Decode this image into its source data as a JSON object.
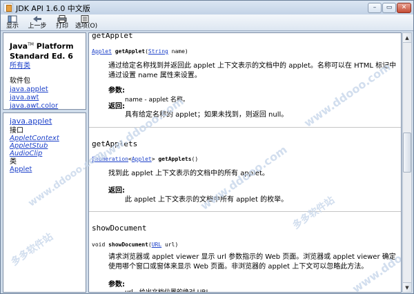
{
  "window": {
    "title": "JDK API 1.6.0 中文版",
    "controls": [
      "–",
      "▭",
      "✕"
    ]
  },
  "toolbar": {
    "buttons": [
      {
        "label": "显示",
        "icon": "show-icon"
      },
      {
        "label": "上一步",
        "icon": "back-arrow-icon"
      },
      {
        "label": "打印",
        "icon": "print-icon"
      },
      {
        "label": "选项(O)",
        "icon": "options-icon"
      }
    ]
  },
  "top_pane": {
    "title": "Java™ Platform Standard Ed. 6",
    "title_tm": "TM",
    "title_pre": "Java",
    "title_post": " Platform Standard Ed. 6",
    "all_classes": "所有类",
    "packages_label": "软件包",
    "packages": [
      "java.applet",
      "java.awt",
      "java.awt.color"
    ]
  },
  "bottom_pane": {
    "package": "java.applet",
    "interfaces_label": "接口",
    "interfaces": [
      "AppletContext",
      "AppletStub",
      "AudioClip"
    ],
    "classes_label": "类",
    "classes": [
      "Applet"
    ]
  },
  "main": {
    "sections": [
      {
        "name": "getApplet",
        "sig_type": "Applet",
        "sig_method": "getApplet",
        "sig_paren_open": "(",
        "sig_param_type": "String",
        "sig_param": " name)",
        "desc": "通过给定名称找到并返回此 applet 上下文表示的文档中的 applet。名称可以在 HTML 标记中通过设置 name 属性来设置。",
        "params_label": "参数:",
        "param_text": "name - applet 名称。",
        "returns_label": "返回:",
        "returns_text": "具有给定名称的 applet；如果未找到，则返回 null。"
      },
      {
        "name": "getApplets",
        "sig_type": "Enumeration",
        "sig_generic_open": "<",
        "sig_generic": "Applet",
        "sig_generic_close": ">",
        "sig_method": " getApplets",
        "sig_rest": "()",
        "desc": "找到此 applet 上下文表示的文档中的所有 applet。",
        "returns_label": "返回:",
        "returns_text": "此 applet 上下文表示的文档中所有 applet 的枚举。"
      },
      {
        "name": "showDocument",
        "sig_pre": "void ",
        "sig_method": "showDocument",
        "sig_paren_open": "(",
        "sig_param_type": "URL",
        "sig_param": " url)",
        "desc": "请求浏览器或 applet viewer 显示 url 参数指示的 Web 页面。浏览器或 applet viewer 确定使用哪个窗口或窗体来显示 Web 页面。非浏览器的 applet 上下文可以忽略此方法。",
        "params_label": "参数:",
        "param_text": "url - 给出文档位置的绝对 URL。"
      }
    ]
  },
  "watermark": {
    "cn": "多多软件站",
    "url": "www.ddooo.com"
  },
  "colors": {
    "link": "#1a3fc9",
    "window_frame": "#cfdcea",
    "watermark": "#c7d7eb"
  }
}
